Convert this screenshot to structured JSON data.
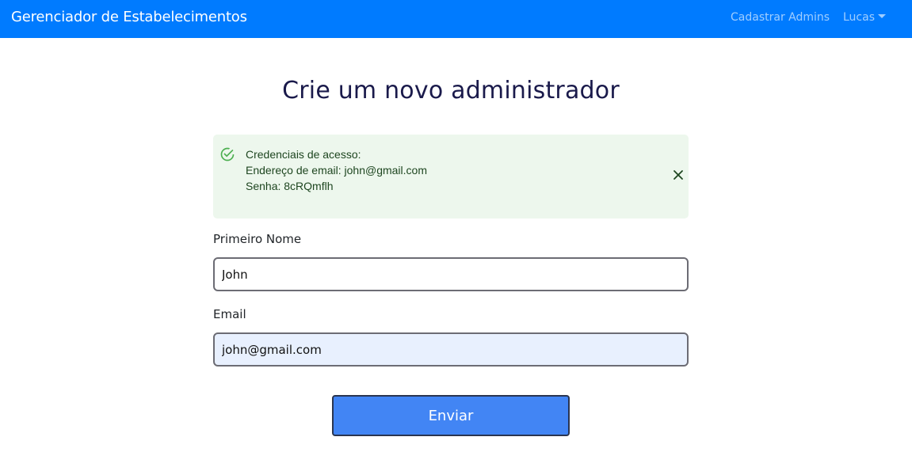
{
  "navbar": {
    "brand": "Gerenciador de Estabelecimentos",
    "links": {
      "admins": "Cadastrar Admins",
      "user": "Lucas"
    },
    "background": "#007bff"
  },
  "page": {
    "title": "Crie um novo administrador"
  },
  "alert": {
    "type": "success",
    "icon": "check-circle-icon",
    "close_icon": "close-icon",
    "lines": [
      "Credenciais de acesso:",
      "Endereço de email: john@gmail.com",
      "Senha: 8cRQmflh"
    ],
    "background": "#edf7ed",
    "icon_color": "#4caf50"
  },
  "form": {
    "first_name": {
      "label": "Primeiro Nome",
      "value": "John"
    },
    "email": {
      "label": "Email",
      "value": "john@gmail.com"
    },
    "submit_label": "Enviar",
    "submit_color": "#4285f4"
  }
}
